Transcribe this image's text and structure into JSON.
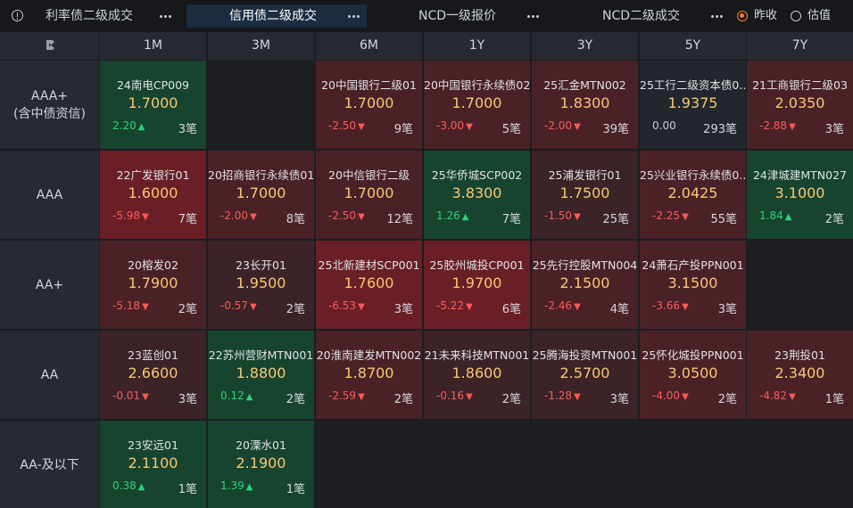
{
  "tabs": [
    {
      "label": "利率债二级成交",
      "active": false
    },
    {
      "label": "信用债二级成交",
      "active": true
    },
    {
      "label": "NCD一级报价",
      "active": false
    },
    {
      "label": "NCD二级成交",
      "active": false
    }
  ],
  "radios": [
    {
      "label": "昨收",
      "checked": true
    },
    {
      "label": "估值",
      "checked": false
    }
  ],
  "icons": {
    "info": "info-icon",
    "more": "more-dots-icon",
    "corner": "brand-logo-icon"
  },
  "columns": [
    "1M",
    "3M",
    "6M",
    "1Y",
    "3Y",
    "5Y",
    "7Y"
  ],
  "rows": [
    {
      "label": [
        "AAA+",
        "(含中债资信)"
      ],
      "cells": [
        {
          "name": "24南电CP009",
          "rate": "1.7000",
          "change": "2.20",
          "dir": "up",
          "count": "3笔",
          "tone": "green"
        },
        null,
        {
          "name": "20中国银行二级01",
          "rate": "1.7000",
          "change": "-2.50",
          "dir": "down",
          "count": "9笔",
          "tone": "red"
        },
        {
          "name": "20中国银行永续债02",
          "rate": "1.7000",
          "change": "-3.00",
          "dir": "down",
          "count": "5笔",
          "tone": "red"
        },
        {
          "name": "25汇金MTN002",
          "rate": "1.8300",
          "change": "-2.00",
          "dir": "down",
          "count": "39笔",
          "tone": "red"
        },
        {
          "name": "25工行二级资本债0...",
          "rate": "1.9375",
          "change": "0.00",
          "dir": "flat",
          "count": "293笔",
          "tone": "neutral"
        },
        {
          "name": "21工商银行二级03",
          "rate": "2.0350",
          "change": "-2.88",
          "dir": "down",
          "count": "3笔",
          "tone": "red"
        }
      ]
    },
    {
      "label": [
        "AAA"
      ],
      "cells": [
        {
          "name": "22广发银行01",
          "rate": "1.6000",
          "change": "-5.98",
          "dir": "down",
          "count": "7笔",
          "tone": "dred"
        },
        {
          "name": "20招商银行永续债01",
          "rate": "1.7000",
          "change": "-2.00",
          "dir": "down",
          "count": "8笔",
          "tone": "red"
        },
        {
          "name": "20中信银行二级",
          "rate": "1.7000",
          "change": "-2.50",
          "dir": "down",
          "count": "12笔",
          "tone": "red"
        },
        {
          "name": "25华侨城SCP002",
          "rate": "3.8300",
          "change": "1.26",
          "dir": "up",
          "count": "7笔",
          "tone": "green"
        },
        {
          "name": "25浦发银行01",
          "rate": "1.7500",
          "change": "-1.50",
          "dir": "down",
          "count": "25笔",
          "tone": "mid"
        },
        {
          "name": "25兴业银行永续债0...",
          "rate": "2.0425",
          "change": "-2.25",
          "dir": "down",
          "count": "55笔",
          "tone": "red"
        },
        {
          "name": "24津城建MTN027",
          "rate": "3.1000",
          "change": "1.84",
          "dir": "up",
          "count": "2笔",
          "tone": "green"
        }
      ]
    },
    {
      "label": [
        "AA+"
      ],
      "cells": [
        {
          "name": "20榕发02",
          "rate": "1.7900",
          "change": "-5.18",
          "dir": "down",
          "count": "2笔",
          "tone": "red"
        },
        {
          "name": "23长开01",
          "rate": "1.9500",
          "change": "-0.57",
          "dir": "down",
          "count": "2笔",
          "tone": "mid"
        },
        {
          "name": "25北新建材SCP001",
          "rate": "1.7600",
          "change": "-6.53",
          "dir": "down",
          "count": "3笔",
          "tone": "dred"
        },
        {
          "name": "25胶州城投CP001",
          "rate": "1.9700",
          "change": "-5.22",
          "dir": "down",
          "count": "6笔",
          "tone": "dred"
        },
        {
          "name": "25先行控股MTN004",
          "rate": "2.1500",
          "change": "-2.46",
          "dir": "down",
          "count": "4笔",
          "tone": "red"
        },
        {
          "name": "24萧石产投PPN001",
          "rate": "3.1500",
          "change": "-3.66",
          "dir": "down",
          "count": "3笔",
          "tone": "red"
        },
        null
      ]
    },
    {
      "label": [
        "AA"
      ],
      "cells": [
        {
          "name": "23蓝创01",
          "rate": "2.6600",
          "change": "-0.01",
          "dir": "down",
          "count": "3笔",
          "tone": "mid"
        },
        {
          "name": "22苏州营财MTN001",
          "rate": "1.8800",
          "change": "0.12",
          "dir": "up",
          "count": "2笔",
          "tone": "green"
        },
        {
          "name": "20淮南建发MTN002",
          "rate": "1.8700",
          "change": "-2.59",
          "dir": "down",
          "count": "2笔",
          "tone": "red"
        },
        {
          "name": "21未来科技MTN001",
          "rate": "1.8600",
          "change": "-0.16",
          "dir": "down",
          "count": "2笔",
          "tone": "mid"
        },
        {
          "name": "25腾海投资MTN001",
          "rate": "2.5700",
          "change": "-1.28",
          "dir": "down",
          "count": "3笔",
          "tone": "mid"
        },
        {
          "name": "25怀化城投PPN001",
          "rate": "3.0500",
          "change": "-4.00",
          "dir": "down",
          "count": "2笔",
          "tone": "red"
        },
        {
          "name": "23荆投01",
          "rate": "2.3400",
          "change": "-4.82",
          "dir": "down",
          "count": "1笔",
          "tone": "red"
        }
      ]
    },
    {
      "label": [
        "AA-及以下"
      ],
      "cells": [
        {
          "name": "23安远01",
          "rate": "2.1100",
          "change": "0.38",
          "dir": "up",
          "count": "1笔",
          "tone": "green"
        },
        {
          "name": "20溧水01",
          "rate": "2.1900",
          "change": "1.39",
          "dir": "up",
          "count": "1笔",
          "tone": "green"
        },
        null,
        null,
        null,
        null,
        null
      ]
    }
  ],
  "colors": {
    "down": "#ff5a5a",
    "up": "#2fd27a",
    "rate": "#f7c873",
    "accent": "#ff7a1a",
    "active_tab_bg": "#1c2d42"
  }
}
